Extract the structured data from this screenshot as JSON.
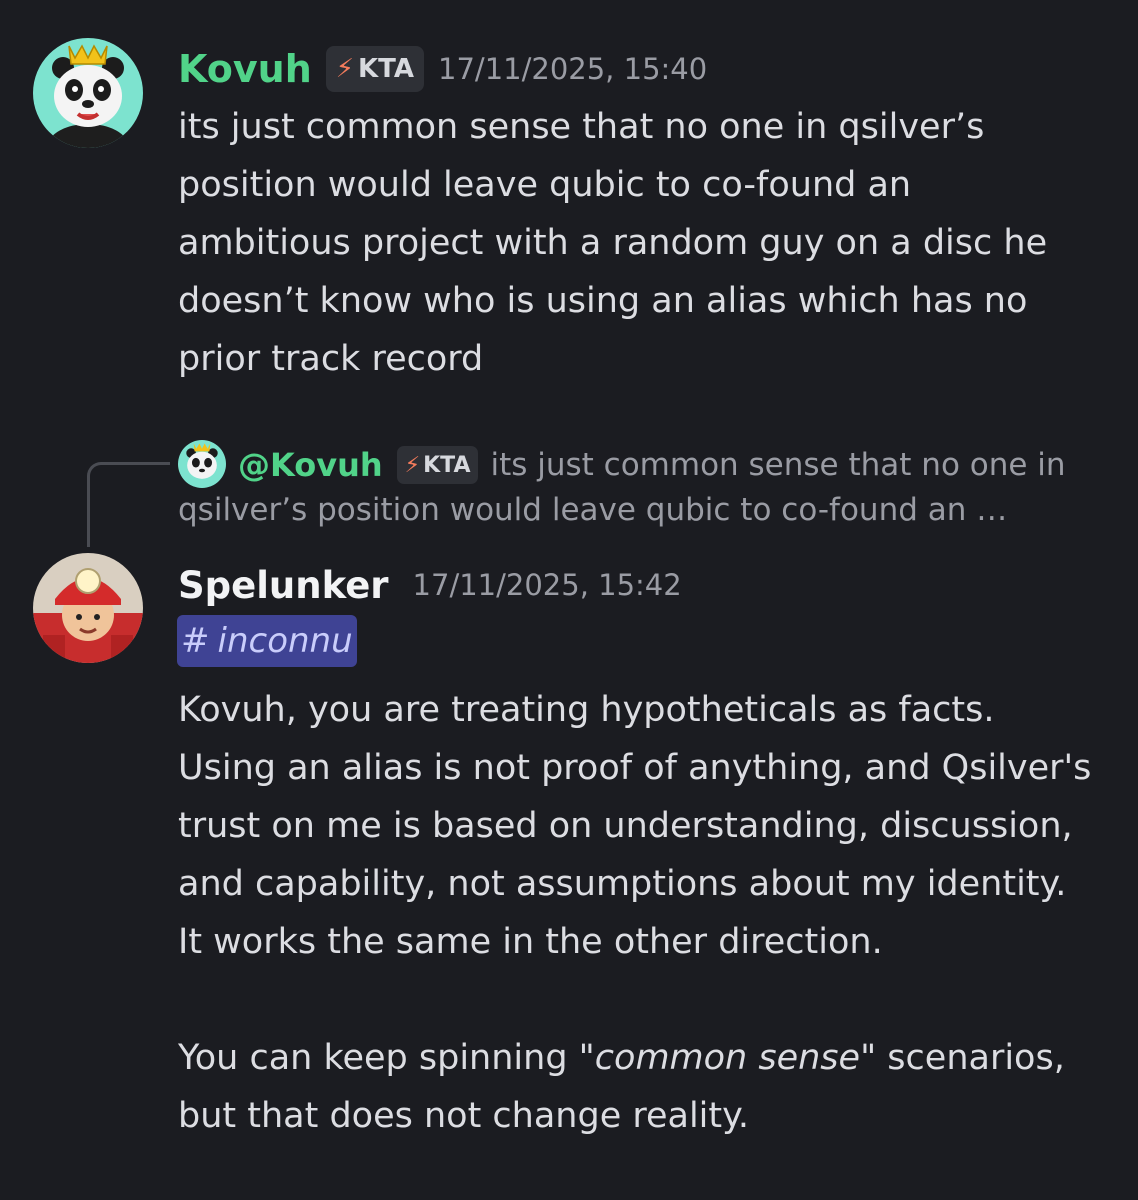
{
  "messages": [
    {
      "author": "Kovuh",
      "tag": "KTA",
      "timestamp": "17/11/2025, 15:40",
      "lines": [
        "its just common sense that no one in qsilver’s",
        "position would leave qubic to co-found an",
        "ambitious project with a random guy on a disc he",
        "doesn’t know who is using an alias which has no",
        "prior track record"
      ]
    },
    {
      "reply": {
        "author": "@Kovuh",
        "tag": "KTA",
        "text_line1": "its just common sense that no one in",
        "text_line2": "qsilver’s position would leave qubic to co-found an …"
      },
      "author": "Spelunker",
      "timestamp": "17/11/2025, 15:42",
      "channel_mention": {
        "hash": "#",
        "name": "inconnu"
      },
      "lines": [
        "Kovuh, you are treating hypotheticals as facts.",
        "Using an alias is not proof of anything, and Qsilver's",
        "trust on me is based on understanding, discussion,",
        "and capability, not assumptions about my identity.",
        "It works the same in the other direction."
      ],
      "line6_before": "You can keep spinning \"",
      "line6_italic": "common sense",
      "line6_after": "\" scenarios,",
      "line7": "but that does not change reality."
    }
  ],
  "icons": {
    "tag_icon": "lightning-bolt-icon",
    "bolt_glyph": "⚡"
  },
  "colors": {
    "username_green": "#51d389",
    "background": "#1b1c21",
    "mention_bg": "#3f4394"
  }
}
